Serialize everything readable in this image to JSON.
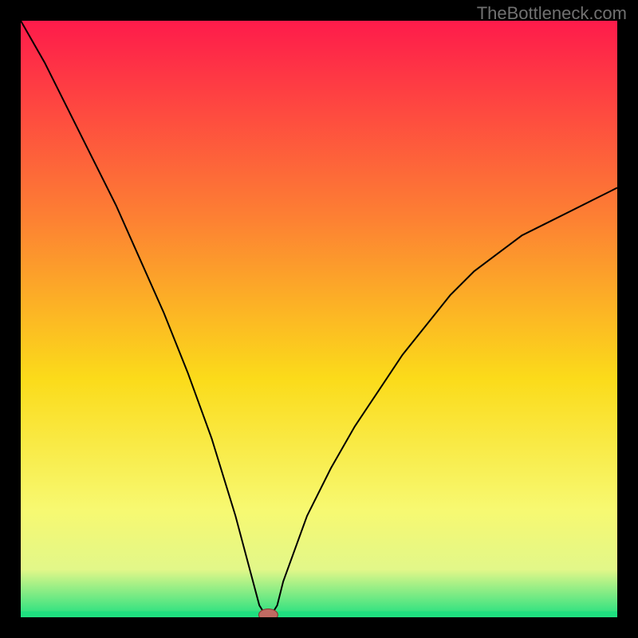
{
  "watermark": "TheBottleneck.com",
  "colors": {
    "frame": "#000000",
    "watermark": "#717171",
    "curve": "#000000",
    "marker_fill": "#c06a62",
    "marker_stroke": "#8a3a33"
  },
  "chart_data": {
    "type": "line",
    "title": "",
    "xlabel": "",
    "ylabel": "",
    "xlim": [
      0,
      100
    ],
    "ylim": [
      0,
      100
    ],
    "gradient_stops": [
      {
        "offset": 0,
        "color": "#fe1b4b"
      },
      {
        "offset": 33,
        "color": "#fd8033"
      },
      {
        "offset": 60,
        "color": "#fbdb1a"
      },
      {
        "offset": 82,
        "color": "#f7f971"
      },
      {
        "offset": 92,
        "color": "#e2f789"
      },
      {
        "offset": 100,
        "color": "#1fe080"
      }
    ],
    "green_band": {
      "y_from": 0.0,
      "y_to": 1.0
    },
    "series": [
      {
        "name": "bottleneck-curve",
        "x": [
          0,
          4,
          8,
          12,
          16,
          20,
          24,
          28,
          32,
          36,
          40,
          41,
          42,
          43,
          44,
          48,
          52,
          56,
          60,
          64,
          68,
          72,
          76,
          80,
          84,
          88,
          92,
          96,
          100
        ],
        "y": [
          100,
          93,
          85,
          77,
          69,
          60,
          51,
          41,
          30,
          17,
          2,
          0.4,
          0.4,
          2,
          6,
          17,
          25,
          32,
          38,
          44,
          49,
          54,
          58,
          61,
          64,
          66,
          68,
          70,
          72
        ]
      }
    ],
    "marker": {
      "x": 41.5,
      "y": 0.4,
      "rx": 1.6,
      "ry": 1.0
    }
  }
}
